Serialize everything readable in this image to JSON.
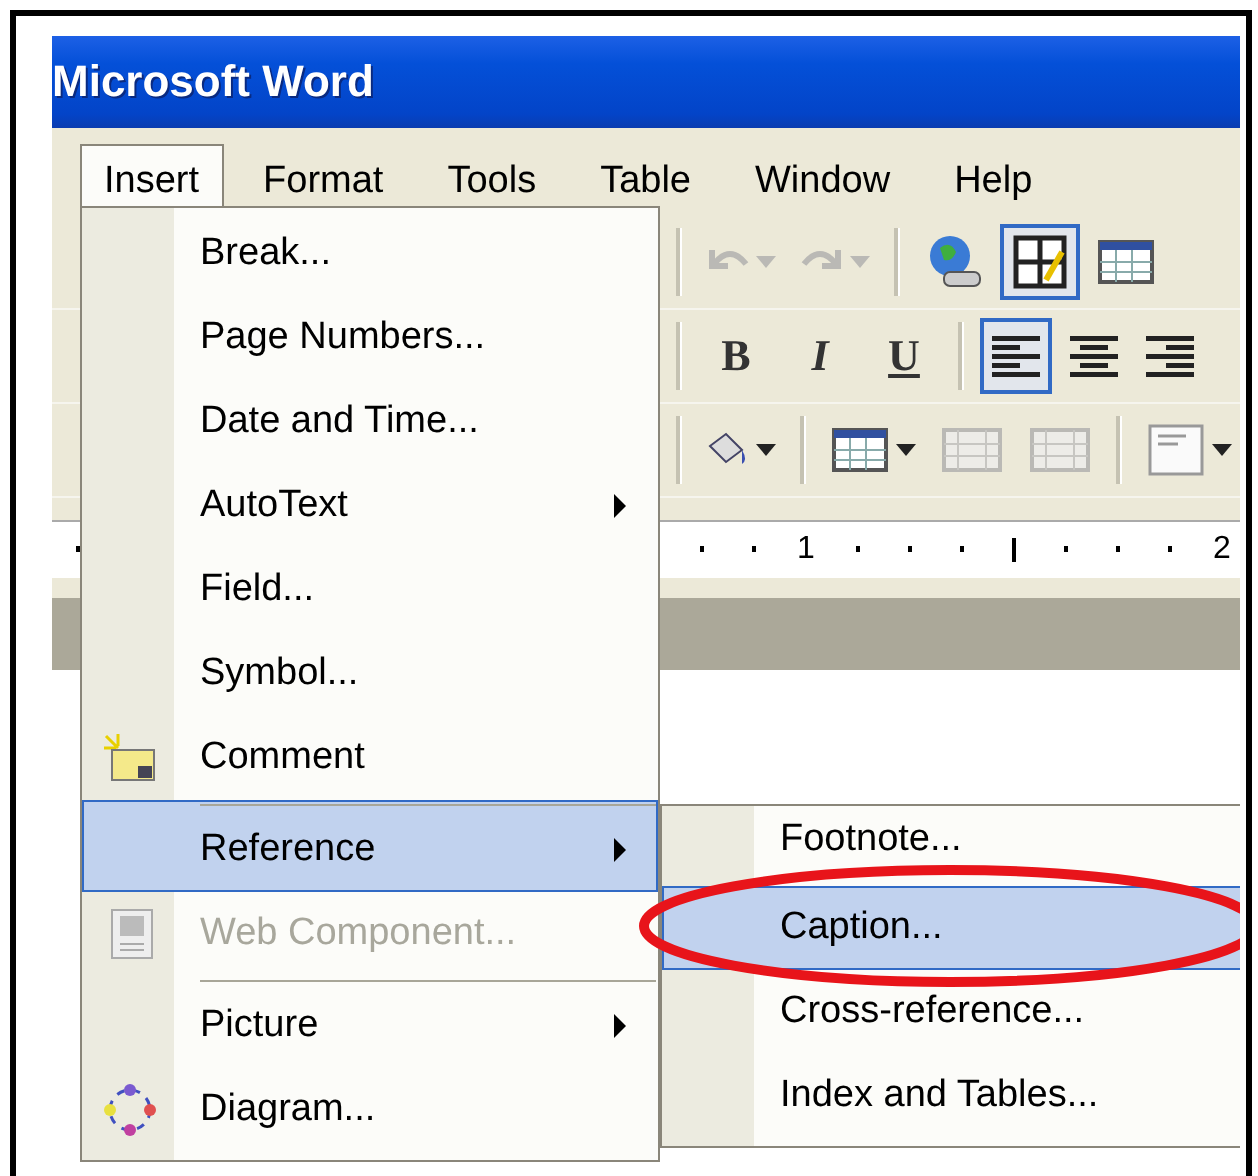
{
  "window": {
    "title": "Microsoft Word"
  },
  "menu_bar": [
    {
      "label": "Insert",
      "selected": true
    },
    {
      "label": "Format",
      "selected": false
    },
    {
      "label": "Tools",
      "selected": false
    },
    {
      "label": "Table",
      "selected": false
    },
    {
      "label": "Window",
      "selected": false
    },
    {
      "label": "Help",
      "selected": false
    }
  ],
  "toolbars": [
    [
      {
        "kind": "undo",
        "disabled": true,
        "selected": false
      },
      {
        "kind": "redo",
        "disabled": true,
        "selected": false
      },
      {
        "kind": "hyperlink",
        "disabled": false,
        "selected": false
      },
      {
        "kind": "draw-table",
        "disabled": false,
        "selected": true
      },
      {
        "kind": "insert-table",
        "disabled": false,
        "selected": false
      }
    ],
    [
      {
        "kind": "bold",
        "label": "B",
        "disabled": false,
        "selected": false
      },
      {
        "kind": "italic",
        "label": "I",
        "disabled": false,
        "selected": false
      },
      {
        "kind": "underline",
        "label": "U",
        "disabled": false,
        "selected": false
      },
      {
        "kind": "align-left",
        "disabled": false,
        "selected": true
      },
      {
        "kind": "align-center",
        "disabled": false,
        "selected": false
      },
      {
        "kind": "align-right",
        "disabled": false,
        "selected": false
      }
    ],
    [
      {
        "kind": "fill-color",
        "disabled": false,
        "selected": false
      },
      {
        "kind": "table-menu",
        "disabled": false,
        "selected": false
      },
      {
        "kind": "merge-cells",
        "disabled": true,
        "selected": false
      },
      {
        "kind": "split-cells",
        "disabled": true,
        "selected": false
      },
      {
        "kind": "text-box",
        "disabled": false,
        "selected": false
      }
    ]
  ],
  "ruler": {
    "labels": [
      "1",
      "2"
    ]
  },
  "insert_menu": {
    "items": [
      {
        "label": "Break...",
        "kind": "plain",
        "separator_before": false,
        "submenu": false,
        "disabled": false,
        "selected": false
      },
      {
        "label": "Page Numbers...",
        "kind": "plain",
        "separator_before": false,
        "submenu": false,
        "disabled": false,
        "selected": false
      },
      {
        "label": "Date and Time...",
        "kind": "plain",
        "separator_before": false,
        "submenu": false,
        "disabled": false,
        "selected": false
      },
      {
        "label": "AutoText",
        "kind": "plain",
        "separator_before": false,
        "submenu": true,
        "disabled": false,
        "selected": false
      },
      {
        "label": "Field...",
        "kind": "plain",
        "separator_before": false,
        "submenu": false,
        "disabled": false,
        "selected": false
      },
      {
        "label": "Symbol...",
        "kind": "plain",
        "separator_before": false,
        "submenu": false,
        "disabled": false,
        "selected": false
      },
      {
        "label": "Comment",
        "kind": "comment",
        "separator_before": false,
        "submenu": false,
        "disabled": false,
        "selected": false
      },
      {
        "label": "Reference",
        "kind": "plain",
        "separator_before": true,
        "submenu": true,
        "disabled": false,
        "selected": true
      },
      {
        "label": "Web Component...",
        "kind": "web-component",
        "separator_before": false,
        "submenu": false,
        "disabled": true,
        "selected": false
      },
      {
        "label": "Picture",
        "kind": "plain",
        "separator_before": true,
        "submenu": true,
        "disabled": false,
        "selected": false
      },
      {
        "label": "Diagram...",
        "kind": "diagram",
        "separator_before": false,
        "submenu": false,
        "disabled": false,
        "selected": false
      }
    ]
  },
  "reference_submenu": {
    "items": [
      {
        "label": "Footnote...",
        "selected": false
      },
      {
        "label": "Caption...",
        "selected": true
      },
      {
        "label": "Cross-reference...",
        "selected": false
      },
      {
        "label": "Index and Tables...",
        "selected": false
      }
    ]
  },
  "annotation": {
    "kind": "ellipse"
  }
}
